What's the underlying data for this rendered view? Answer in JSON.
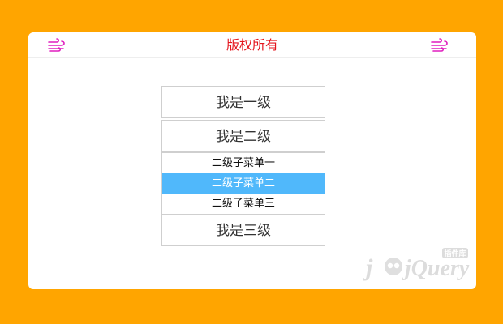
{
  "colors": {
    "backdrop": "#ffa500",
    "card": "#ffffff",
    "title": "#e4141c",
    "icon": "#e01fbf",
    "text": "#333333",
    "submenu_text": "#111111",
    "active_bg": "#50b8fb",
    "active_text": "#ffffff",
    "watermark": "#dcdcdc"
  },
  "header": {
    "title": "版权所有",
    "left_icon": "wind-icon",
    "right_icon": "wind-icon"
  },
  "menu": {
    "items": [
      {
        "label": "我是一级"
      },
      {
        "label": "我是二级"
      },
      {
        "label": "我是三级"
      }
    ],
    "submenu": {
      "items": [
        {
          "label": "二级子菜单一"
        },
        {
          "label": "二级子菜单二",
          "active": true
        },
        {
          "label": "二级子菜单三"
        }
      ]
    }
  },
  "watermark": {
    "logo": "jquery-plugin-library-logo",
    "text": "jQuery",
    "badge": "插件库"
  }
}
